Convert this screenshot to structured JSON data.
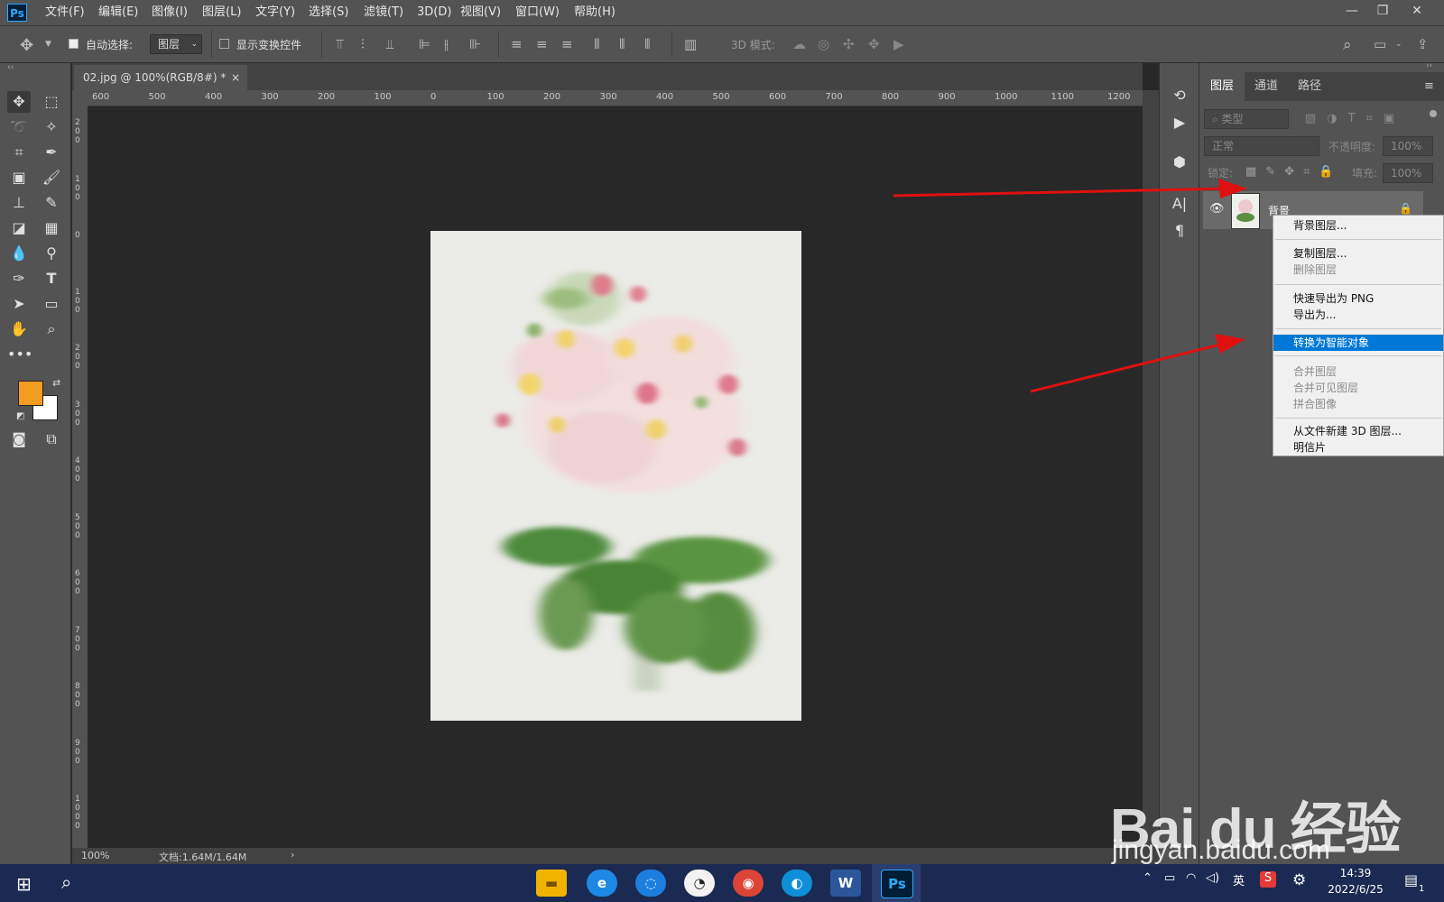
{
  "app": {
    "logo": "Ps"
  },
  "menu": [
    "文件(F)",
    "编辑(E)",
    "图像(I)",
    "图层(L)",
    "文字(Y)",
    "选择(S)",
    "滤镜(T)",
    "3D(D)",
    "视图(V)",
    "窗口(W)",
    "帮助(H)"
  ],
  "window_controls": {
    "minimize": "—",
    "restore": "❐",
    "close": "✕"
  },
  "options": {
    "auto_select_label": "自动选择:",
    "auto_select_value": "图层",
    "show_transform_label": "显示变换控件",
    "mode_3d_label": "3D 模式:"
  },
  "document": {
    "tab_title": "02.jpg @ 100%(RGB/8#) *",
    "tab_close": "×",
    "zoom": "100%",
    "doc_info": "文档:1.64M/1.64M"
  },
  "rulers": {
    "h_ticks": [
      "600",
      "500",
      "400",
      "300",
      "200",
      "100",
      "0",
      "100",
      "200",
      "300",
      "400",
      "500",
      "600",
      "700",
      "800",
      "900",
      "1000",
      "1100",
      "1200"
    ],
    "v_ticks": [
      "200",
      "100",
      "0",
      "100",
      "200",
      "300",
      "400",
      "500",
      "600",
      "700",
      "800",
      "900",
      "1000"
    ]
  },
  "colors": {
    "foreground": "#f39c1f",
    "background": "#ffffff",
    "selection": "#0078d7",
    "arrow": "#e01010"
  },
  "panel": {
    "tabs": [
      "图层",
      "通道",
      "路径"
    ],
    "filter_placeholder": "类型",
    "blend_mode": "正常",
    "opacity_label": "不透明度:",
    "opacity_value": "100%",
    "lock_label": "锁定:",
    "fill_label": "填充:",
    "fill_value": "100%",
    "layer_name": "背景"
  },
  "context_menu": {
    "items": [
      {
        "label": "背景图层...",
        "state": "normal"
      },
      {
        "label": "复制图层...",
        "state": "normal"
      },
      {
        "label": "删除图层",
        "state": "disabled"
      },
      {
        "label": "快速导出为 PNG",
        "state": "normal"
      },
      {
        "label": "导出为...",
        "state": "normal"
      },
      {
        "label": "转换为智能对象",
        "state": "selected"
      },
      {
        "label": "合并图层",
        "state": "disabled"
      },
      {
        "label": "合并可见图层",
        "state": "disabled"
      },
      {
        "label": "拼合图像",
        "state": "disabled"
      },
      {
        "label": "从文件新建 3D 图层...",
        "state": "normal"
      },
      {
        "label": "明信片",
        "state": "normal"
      }
    ]
  },
  "taskbar": {
    "clock_time": "14:39",
    "clock_date": "2022/6/25",
    "ime": "英",
    "notification_count": "1",
    "word_label": "W",
    "ps_label": "Ps"
  },
  "watermark": {
    "brand": "Bai du 经验",
    "url": "jingyan.baidu.com"
  }
}
